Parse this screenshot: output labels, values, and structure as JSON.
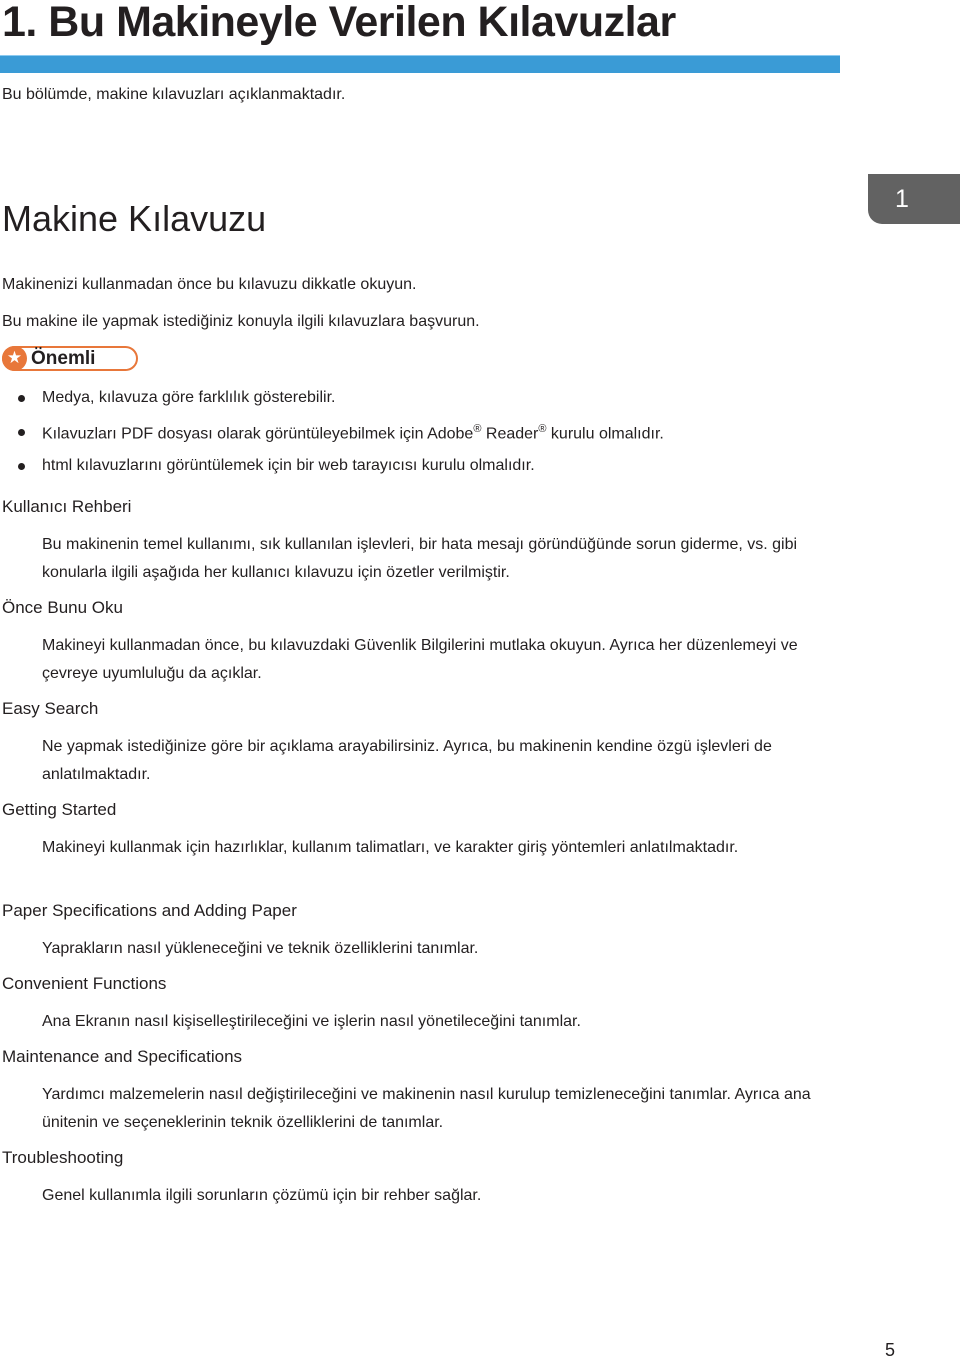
{
  "chapter": {
    "title": "1. Bu Makineyle Verilen Kılavuzlar",
    "intro": "Bu bölümde, makine kılavuzları açıklanmaktadır.",
    "tab_number": "1"
  },
  "section": {
    "title": "Makine Kılavuzu",
    "paragraphs": [
      "Makinenizi kullanmadan önce bu kılavuzu dikkatle okuyun.",
      "Bu makine ile yapmak istediğiniz konuyla ilgili kılavuzlara başvurun."
    ],
    "important": {
      "icon": "star-icon",
      "label": "Önemli",
      "color": "#e8773a",
      "items": [
        {
          "text": "Medya, kılavuza göre farklılık gösterebilir."
        },
        {
          "pre": "Kılavuzları PDF dosyası olarak görüntüleyebilmek için Adobe",
          "sup1": "®",
          "mid": " Reader",
          "sup2": "®",
          "post": " kurulu olmalıdır."
        },
        {
          "text": "html kılavuzlarını görüntülemek için bir web tarayıcısı kurulu olmalıdır."
        }
      ]
    },
    "manuals": [
      {
        "term": "Kullanıcı Rehberi",
        "desc": "Bu makinenin temel kullanımı, sık kullanılan işlevleri, bir hata mesajı göründüğünde sorun giderme, vs. gibi konularla ilgili aşağıda her kullanıcı kılavuzu için özetler verilmiştir."
      },
      {
        "term": "Önce Bunu Oku",
        "desc": "Makineyi kullanmadan önce, bu kılavuzdaki Güvenlik Bilgilerini mutlaka okuyun. Ayrıca her düzenlemeyi ve çevreye uyumluluğu da açıklar."
      },
      {
        "term": "Easy Search",
        "desc": "Ne yapmak istediğinize göre bir açıklama arayabilirsiniz. Ayrıca, bu makinenin kendine özgü işlevleri de anlatılmaktadır."
      },
      {
        "term": "Getting Started",
        "desc": "Makineyi kullanmak için hazırlıklar, kullanım talimatları, ve karakter giriş yöntemleri anlatılmaktadır."
      },
      {
        "term": "Paper Specifications and Adding Paper",
        "desc": "Yaprakların nasıl yükleneceğini ve teknik özelliklerini tanımlar."
      },
      {
        "term": "Convenient Functions",
        "desc": "Ana Ekranın nasıl kişiselleştirileceğini ve işlerin nasıl yönetileceğini tanımlar."
      },
      {
        "term": "Maintenance and Specifications",
        "desc": "Yardımcı malzemelerin nasıl değiştirileceğini ve makinenin nasıl kurulup temizleneceğini tanımlar. Ayrıca ana ünitenin ve seçeneklerinin teknik özelliklerini de tanımlar."
      },
      {
        "term": "Troubleshooting",
        "desc": "Genel kullanımla ilgili sorunların çözümü için bir rehber sağlar."
      }
    ]
  },
  "footer": {
    "page_number": "5"
  }
}
